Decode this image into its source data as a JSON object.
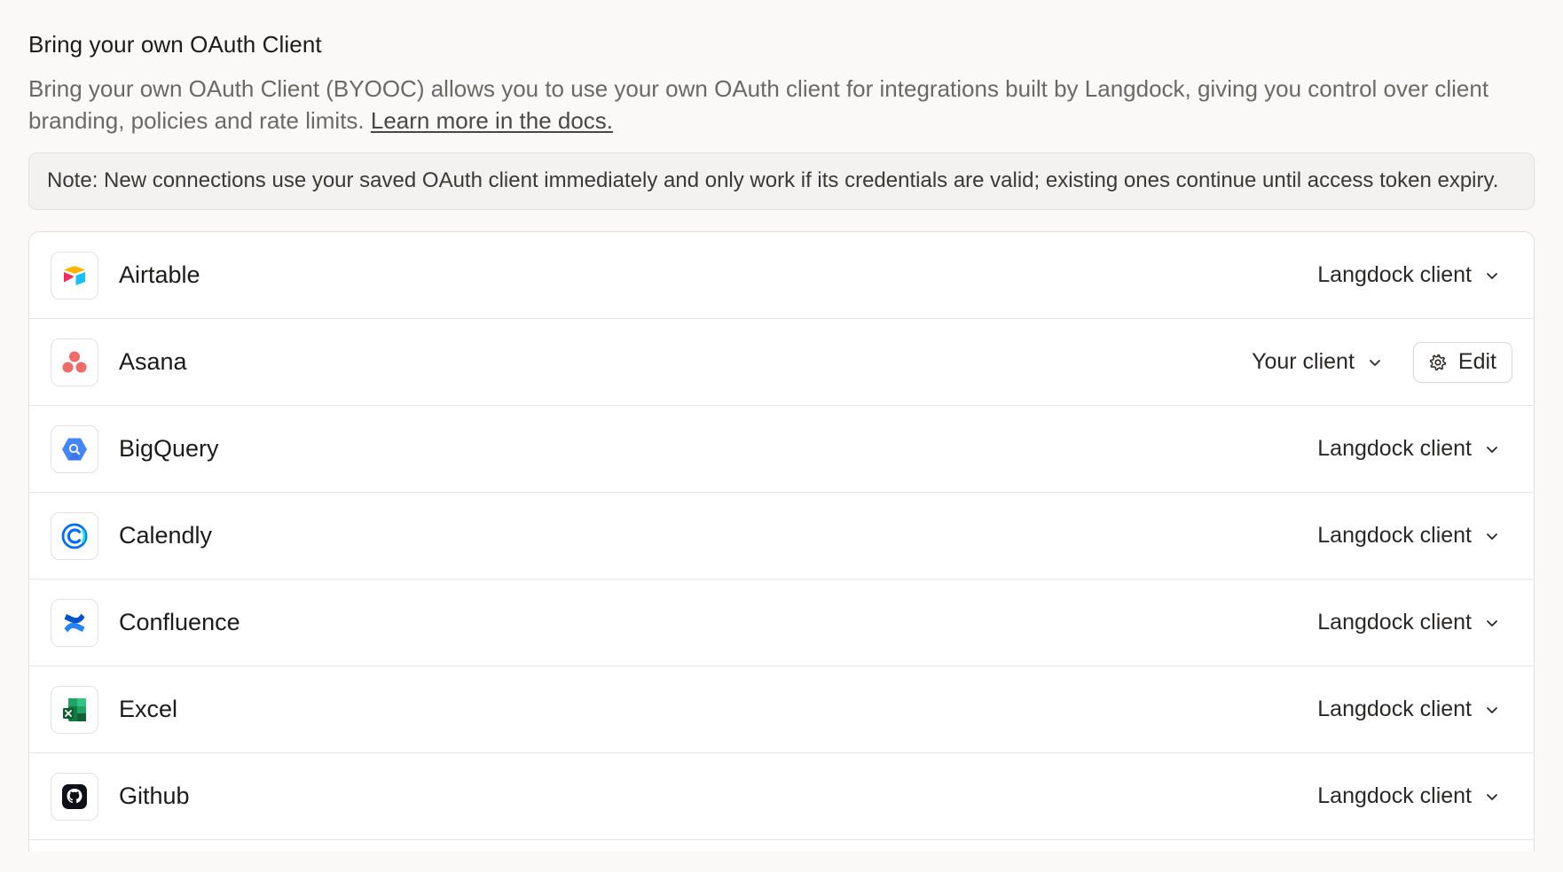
{
  "section": {
    "title": "Bring your own OAuth Client",
    "description": "Bring your own OAuth Client (BYOOC) allows you to use your own OAuth client for integrations built by Langdock, giving you control over client branding, policies and rate limits.",
    "docs_link": "Learn more in the docs.",
    "note": "Note: New connections use your saved OAuth client immediately and only work if its credentials are valid; existing ones continue until access token expiry."
  },
  "integrations": [
    {
      "name": "Airtable",
      "client": "Langdock client",
      "icon": "airtable-icon",
      "editable": false
    },
    {
      "name": "Asana",
      "client": "Your client",
      "icon": "asana-icon",
      "editable": true,
      "edit_label": "Edit"
    },
    {
      "name": "BigQuery",
      "client": "Langdock client",
      "icon": "bigquery-icon",
      "editable": false
    },
    {
      "name": "Calendly",
      "client": "Langdock client",
      "icon": "calendly-icon",
      "editable": false
    },
    {
      "name": "Confluence",
      "client": "Langdock client",
      "icon": "confluence-icon",
      "editable": false
    },
    {
      "name": "Excel",
      "client": "Langdock client",
      "icon": "excel-icon",
      "editable": false
    },
    {
      "name": "Github",
      "client": "Langdock client",
      "icon": "github-icon",
      "editable": false
    }
  ],
  "colors": {
    "background": "#faf9f8",
    "card": "#ffffff",
    "border": "#e2e0dd",
    "note_bg": "#f3f2f0",
    "muted_text": "#6b6966"
  }
}
